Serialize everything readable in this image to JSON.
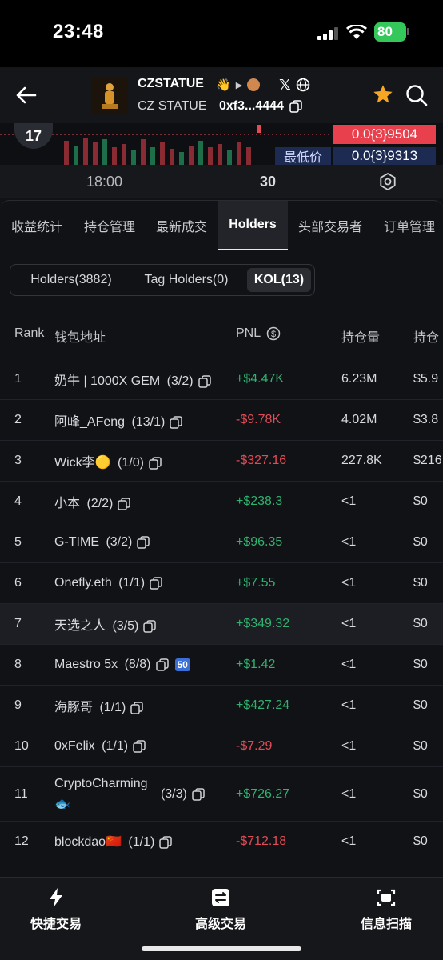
{
  "status_bar": {
    "time": "23:48",
    "battery": "80"
  },
  "header": {
    "token_name": "CZSTATUE",
    "token_subtitle": "CZ STATUE",
    "token_address": "0xf3...4444"
  },
  "chart": {
    "price_current": "0.0{3}9504",
    "low_label": "最低价",
    "price_low": "0.0{3}9313",
    "time_label": "18:00",
    "interval": "30"
  },
  "tabs": [
    "收益统计",
    "持仓管理",
    "最新成交",
    "Holders",
    "头部交易者",
    "订单管理"
  ],
  "active_tab": "Holders",
  "subtabs": [
    "Holders(3882)",
    "Tag Holders(0)",
    "KOL(13)"
  ],
  "active_subtab": "KOL(13)",
  "table": {
    "headers": {
      "rank": "Rank",
      "wallet": "钱包地址",
      "pnl": "PNL",
      "holding": "持仓量",
      "holding_value": "持仓"
    },
    "rows": [
      {
        "rank": "1",
        "name": "奶牛 | 1000X GEM",
        "count": "(3/2)",
        "pnl": "+$4.47K",
        "holding": "6.23M",
        "value": "$5.9"
      },
      {
        "rank": "2",
        "name": "阿峰_AFeng",
        "count": "(13/1)",
        "pnl": "-$9.78K",
        "holding": "4.02M",
        "value": "$3.8"
      },
      {
        "rank": "3",
        "name": "Wick李🟡",
        "count": "(1/0)",
        "pnl": "-$327.16",
        "holding": "227.8K",
        "value": "$216"
      },
      {
        "rank": "4",
        "name": "小本",
        "count": "(2/2)",
        "pnl": "+$238.3",
        "holding": "<1",
        "value": "$0"
      },
      {
        "rank": "5",
        "name": "G-TIME",
        "count": "(3/2)",
        "pnl": "+$96.35",
        "holding": "<1",
        "value": "$0"
      },
      {
        "rank": "6",
        "name": "Onefly.eth",
        "count": "(1/1)",
        "pnl": "+$7.55",
        "holding": "<1",
        "value": "$0"
      },
      {
        "rank": "7",
        "name": "天选之人",
        "count": "(3/5)",
        "pnl": "+$349.32",
        "holding": "<1",
        "value": "$0"
      },
      {
        "rank": "8",
        "name": "Maestro 5x",
        "count": "(8/8)",
        "pnl": "+$1.42",
        "holding": "<1",
        "value": "$0",
        "badge": "50"
      },
      {
        "rank": "9",
        "name": "海豚哥",
        "count": "(1/1)",
        "pnl": "+$427.24",
        "holding": "<1",
        "value": "$0"
      },
      {
        "rank": "10",
        "name": "0xFelix",
        "count": "(1/1)",
        "pnl": "-$7.29",
        "holding": "<1",
        "value": "$0"
      },
      {
        "rank": "11",
        "name": "CryptoCharming",
        "name2": "🐟",
        "count": "(3/3)",
        "pnl": "+$726.27",
        "holding": "<1",
        "value": "$0"
      },
      {
        "rank": "12",
        "name": "blockdao🇨🇳",
        "count": "(1/1)",
        "pnl": "-$712.18",
        "holding": "<1",
        "value": "$0"
      }
    ]
  },
  "bottom_bar": {
    "quick_trade": "快捷交易",
    "advanced_trade": "高级交易",
    "info_scan": "信息扫描"
  },
  "colors": {
    "positive": "#2fb36e",
    "negative": "#e24b56",
    "accent_star": "#f5a623"
  }
}
